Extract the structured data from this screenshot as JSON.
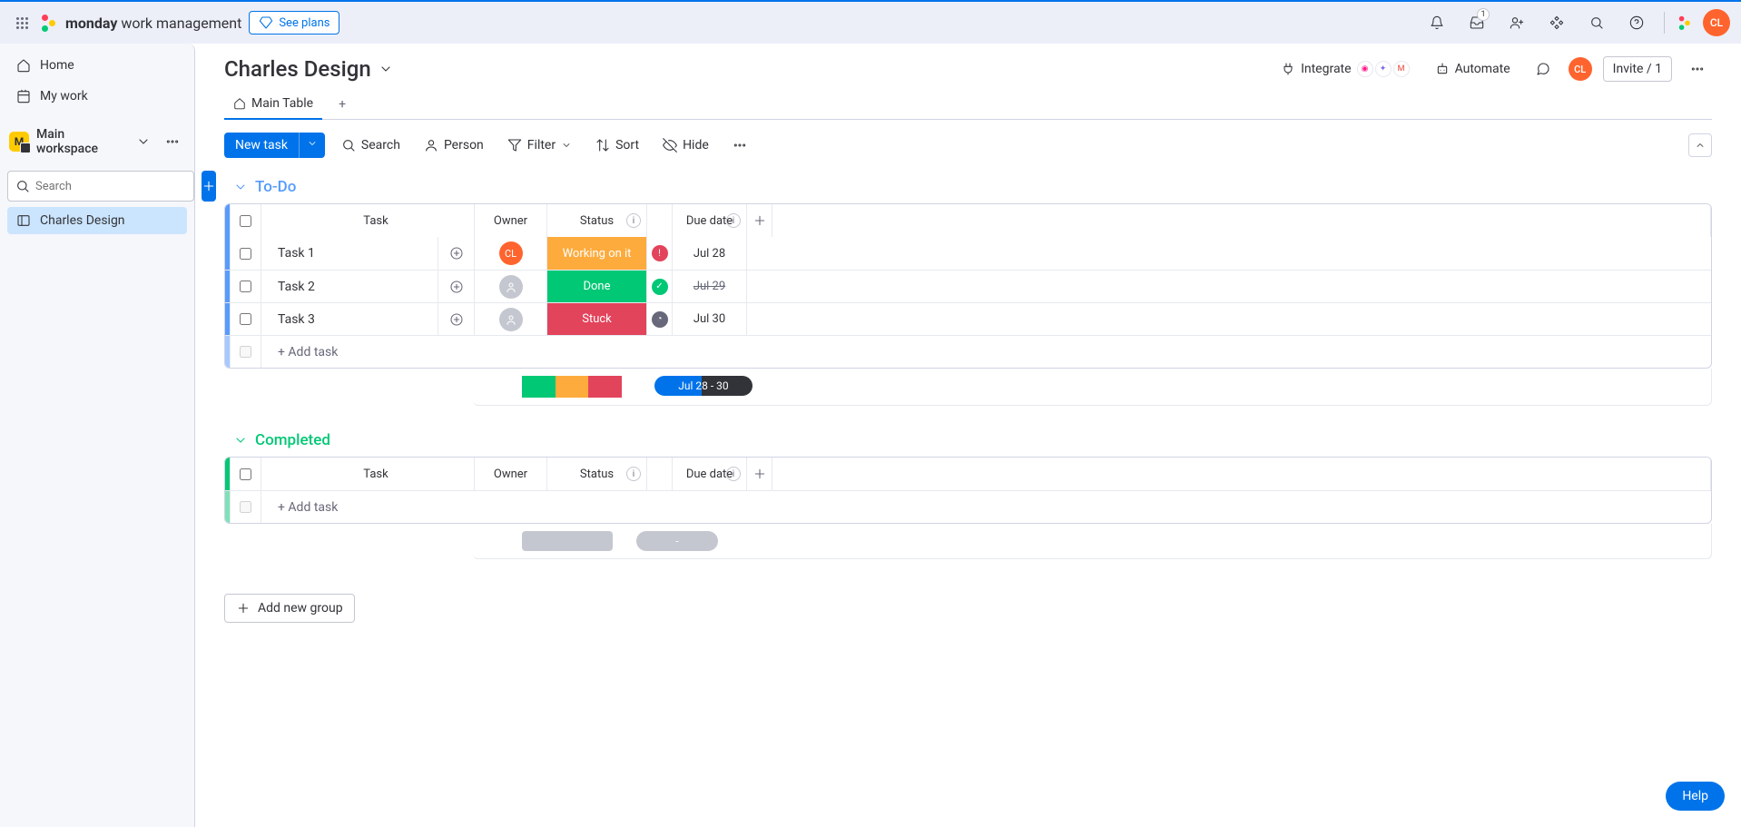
{
  "topbar": {
    "brand_bold": "monday",
    "brand_rest": " work management",
    "see_plans": "See plans",
    "inbox_badge": "1",
    "avatar": "CL"
  },
  "sidebar": {
    "home": "Home",
    "my_work": "My work",
    "workspace": "Main workspace",
    "ws_badge": "M",
    "search_placeholder": "Search",
    "board": "Charles Design"
  },
  "board": {
    "title": "Charles Design",
    "integrate": "Integrate",
    "automate": "Automate",
    "invite": "Invite / 1",
    "main_table": "Main Table"
  },
  "toolbar": {
    "new_task": "New task",
    "search": "Search",
    "person": "Person",
    "filter": "Filter",
    "sort": "Sort",
    "hide": "Hide"
  },
  "columns": {
    "task": "Task",
    "owner": "Owner",
    "status": "Status",
    "due": "Due date"
  },
  "groups": {
    "todo": {
      "name": "To-Do",
      "rows": [
        {
          "task": "Task 1",
          "owner": "CL",
          "status": "Working on it",
          "status_class": "st-working",
          "status_dot": "sd-alert",
          "status_glyph": "!",
          "date": "Jul 28",
          "strike": false
        },
        {
          "task": "Task 2",
          "owner": "",
          "status": "Done",
          "status_class": "st-done",
          "status_dot": "sd-ok",
          "status_glyph": "✓",
          "date": "Jul 29",
          "strike": true
        },
        {
          "task": "Task 3",
          "owner": "",
          "status": "Stuck",
          "status_class": "st-stuck",
          "status_dot": "sd-clock",
          "status_glyph": "◔",
          "date": "Jul 30",
          "strike": false
        }
      ],
      "add_task": "+ Add task",
      "summary_date": "Jul 28 - 30"
    },
    "completed": {
      "name": "Completed",
      "add_task": "+ Add task"
    }
  },
  "add_group": "Add new group",
  "help": "Help"
}
